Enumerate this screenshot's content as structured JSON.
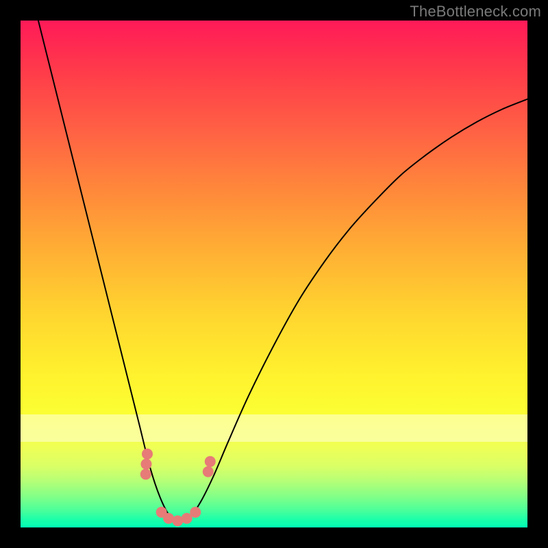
{
  "watermark": "TheBottleneck.com",
  "colors": {
    "frame": "#000000",
    "curve": "#000000",
    "marker": "#e77b77",
    "gradient_top": "#ff1a58",
    "gradient_bottom": "#00ffb3"
  },
  "chart_data": {
    "type": "line",
    "title": "",
    "xlabel": "",
    "ylabel": "",
    "xlim": [
      0,
      1
    ],
    "ylim": [
      0,
      1
    ],
    "grid": false,
    "legend": false,
    "series": [
      {
        "name": "curve",
        "x": [
          0.035,
          0.06,
          0.09,
          0.12,
          0.15,
          0.18,
          0.21,
          0.235,
          0.255,
          0.275,
          0.295,
          0.315,
          0.335,
          0.355,
          0.38,
          0.41,
          0.45,
          0.5,
          0.55,
          0.6,
          0.65,
          0.7,
          0.75,
          0.8,
          0.85,
          0.9,
          0.95,
          1.0
        ],
        "y": [
          1.0,
          0.9,
          0.78,
          0.66,
          0.54,
          0.42,
          0.3,
          0.2,
          0.12,
          0.06,
          0.022,
          0.013,
          0.022,
          0.05,
          0.1,
          0.17,
          0.26,
          0.36,
          0.45,
          0.525,
          0.59,
          0.645,
          0.695,
          0.735,
          0.77,
          0.8,
          0.825,
          0.845
        ]
      },
      {
        "name": "markers-bottom",
        "x": [
          0.278,
          0.292,
          0.31,
          0.328,
          0.345
        ],
        "y": [
          0.03,
          0.018,
          0.013,
          0.018,
          0.03
        ]
      },
      {
        "name": "markers-left-cluster",
        "x": [
          0.25,
          0.248,
          0.247
        ],
        "y": [
          0.145,
          0.125,
          0.105
        ]
      },
      {
        "name": "markers-right-cluster",
        "x": [
          0.37,
          0.374
        ],
        "y": [
          0.11,
          0.13
        ]
      }
    ]
  }
}
